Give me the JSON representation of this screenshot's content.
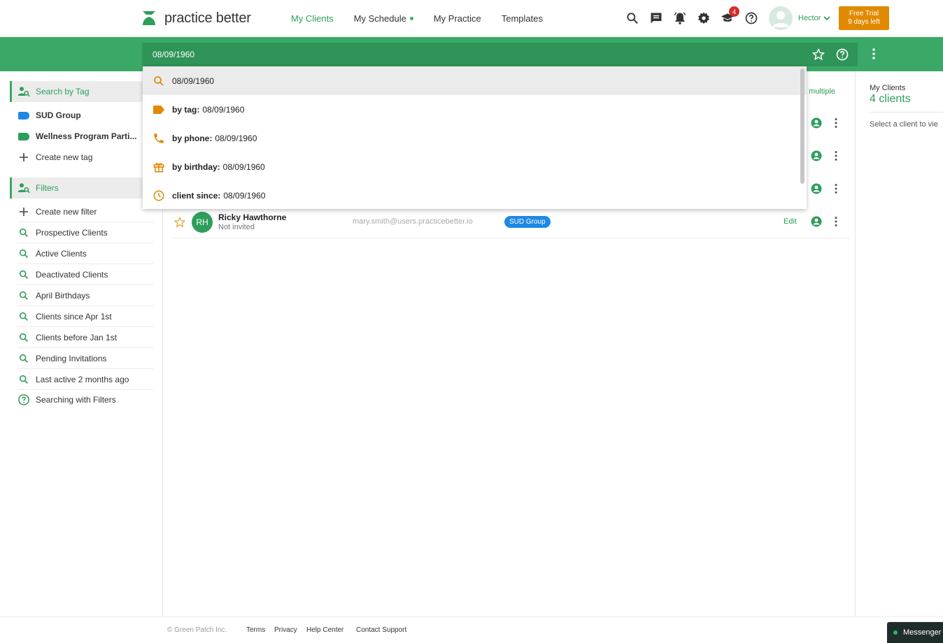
{
  "brand": {
    "name": "practice better",
    "accent": "#3aa866"
  },
  "nav": {
    "items": [
      {
        "label": "My Clients",
        "active": true
      },
      {
        "label": "My Schedule",
        "dot": true
      },
      {
        "label": "My Practice"
      },
      {
        "label": "Templates"
      }
    ]
  },
  "header": {
    "notification_count": "4",
    "user_name": "Hector",
    "trial_line1": "Free Trial",
    "trial_line2": "9 days left"
  },
  "search": {
    "value": "08/09/1960"
  },
  "suggestions": [
    {
      "icon": "search-icon",
      "prefix": "",
      "text": "08/09/1960"
    },
    {
      "icon": "tag-icon",
      "prefix": "by tag:",
      "text": "08/09/1960"
    },
    {
      "icon": "phone-icon",
      "prefix": "by phone:",
      "text": "08/09/1960"
    },
    {
      "icon": "gift-icon",
      "prefix": "by birthday:",
      "text": "08/09/1960"
    },
    {
      "icon": "clock-icon",
      "prefix": "client since:",
      "text": "08/09/1960"
    }
  ],
  "sidebar": {
    "tags_header": "Search by Tag",
    "tags": [
      {
        "label": "SUD Group",
        "color": "#1e88e5"
      },
      {
        "label": "Wellness Program Parti...",
        "color": "#2e9e5b"
      }
    ],
    "create_tag": "Create new tag",
    "filters_header": "Filters",
    "create_filter": "Create new filter",
    "filters": [
      "Prospective Clients",
      "Active Clients",
      "Deactivated Clients",
      "April Birthdays",
      "Clients since Apr 1st",
      "Clients before Jan 1st",
      "Pending Invitations",
      "Last active 2 months ago"
    ],
    "help_filter": "Searching with Filters"
  },
  "list": {
    "select_multiple": "t multiple",
    "client": {
      "initials": "RH",
      "name": "Ricky Hawthorne",
      "status": "Not invited",
      "email": "mary.smith@users.practicebetter.io",
      "tag": "SUD Group",
      "edit": "Edit"
    }
  },
  "right_panel": {
    "title": "My Clients",
    "count": "4 clients",
    "hint": "Select a client to vie"
  },
  "footer": {
    "copyright": "© Green Patch Inc.",
    "terms": "Terms",
    "privacy": "Privacy",
    "help_center": "Help Center",
    "contact": "Contact Support",
    "messenger": "Messenger"
  }
}
